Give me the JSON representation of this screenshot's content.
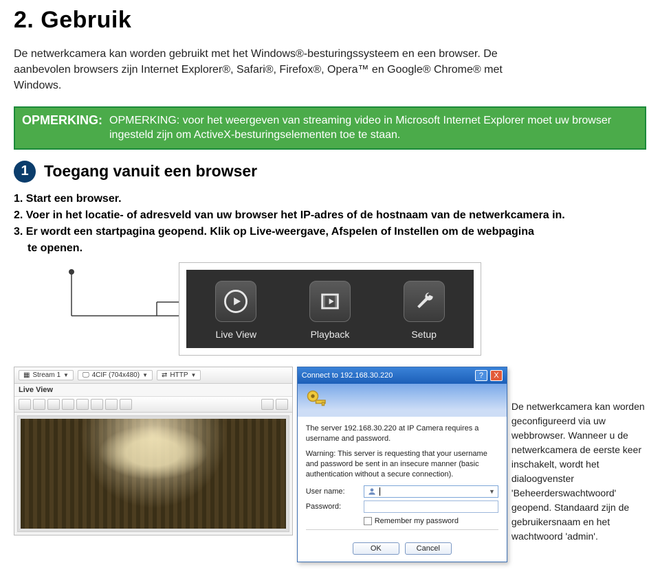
{
  "section": {
    "number_title": "2. Gebruik",
    "intro": "De netwerkcamera kan worden gebruikt met het Windows®-besturingssysteem en een browser. De aanbevolen browsers zijn Internet Explorer®, Safari®, Firefox®, Opera™ en Google® Chrome® met Windows."
  },
  "note": {
    "label": "OPMERKING:",
    "body": "OPMERKING: voor het weergeven van streaming video in Microsoft Internet Explorer moet uw browser ingesteld zijn om ActiveX-besturingselementen toe te staan."
  },
  "step": {
    "badge": "1",
    "title": "Toegang vanuit een browser"
  },
  "instructions": {
    "i1": "1. Start een browser.",
    "i2": "2. Voer in het locatie- of adresveld van uw browser het IP-adres of de hostnaam van de netwerkcamera in.",
    "i3a": "3. Er wordt een startpagina geopend. Klik op Live-weergave, Afspelen of Instellen om de webpagina",
    "i3b": "te openen."
  },
  "tiles": {
    "live_view": "Live View",
    "playback": "Playback",
    "setup": "Setup"
  },
  "live_view_pane": {
    "tab_label": "Live View",
    "dd_stream": "Stream 1",
    "dd_res": "4CIF (704x480)",
    "dd_proto": "HTTP"
  },
  "dialog": {
    "title": "Connect to 192.168.30.220",
    "help": "?",
    "close": "X",
    "msg1": "The server 192.168.30.220 at IP Camera requires a username and password.",
    "msg2": "Warning: This server is requesting that your username and password be sent in an insecure manner (basic authentication without a secure connection).",
    "user_label": "User name:",
    "user_value": "",
    "pass_label": "Password:",
    "remember": "Remember my password",
    "ok": "OK",
    "cancel": "Cancel"
  },
  "caption": "De netwerkcamera kan worden geconfigureerd via uw webbrowser. Wanneer u de netwerkcamera de eerste keer inschakelt, wordt het dialoogvenster 'Beheerderswachtwoord' geopend. Standaard zijn de gebruikersnaam en het wachtwoord 'admin'."
}
